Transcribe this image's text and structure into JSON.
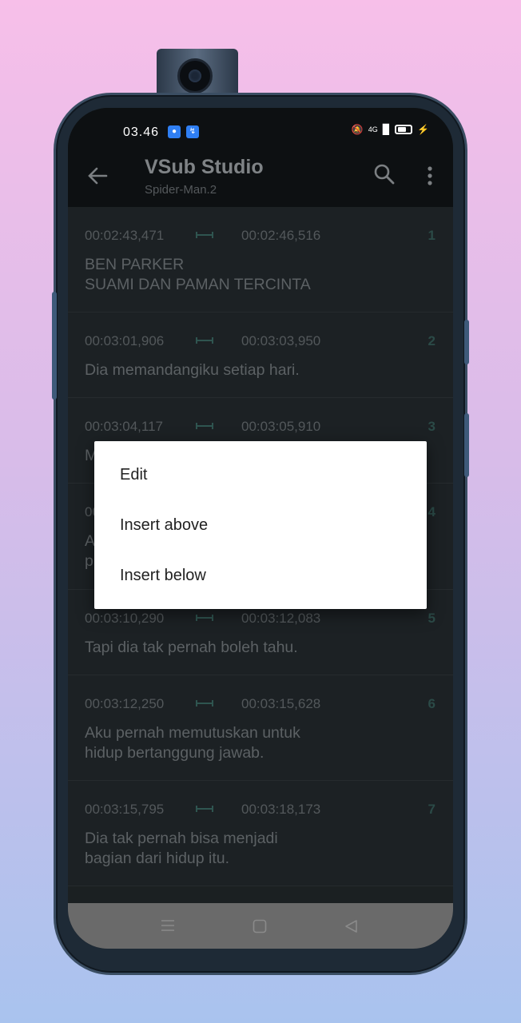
{
  "status_bar": {
    "time": "03.46",
    "network": "4G"
  },
  "app_bar": {
    "title": "VSub Studio",
    "subtitle": "Spider-Man.2"
  },
  "subtitles": [
    {
      "index": "1",
      "start": "00:02:43,471",
      "end": "00:02:46,516",
      "text": "BEN PARKER\nSUAMI DAN PAMAN TERCINTA"
    },
    {
      "index": "2",
      "start": "00:03:01,906",
      "end": "00:03:03,950",
      "text": "Dia memandangiku setiap hari."
    },
    {
      "index": "3",
      "start": "00:03:04,117",
      "end": "00:03:05,910",
      "text": "M"
    },
    {
      "index": "4",
      "start": "00",
      "end": "",
      "text": "A\np"
    },
    {
      "index": "5",
      "start": "00:03:10,290",
      "end": "00:03:12,083",
      "text": "Tapi dia tak pernah boleh tahu."
    },
    {
      "index": "6",
      "start": "00:03:12,250",
      "end": "00:03:15,628",
      "text": "Aku pernah memutuskan untuk\nhidup bertanggung jawab."
    },
    {
      "index": "7",
      "start": "00:03:15,795",
      "end": "00:03:18,173",
      "text": "Dia tak pernah bisa menjadi\nbagian dari hidup itu."
    }
  ],
  "context_menu": {
    "items": [
      "Edit",
      "Insert above",
      "Insert below"
    ]
  },
  "colors": {
    "accent": "#2b4a47",
    "background": "#1c2124",
    "dialog": "#ffffff"
  }
}
